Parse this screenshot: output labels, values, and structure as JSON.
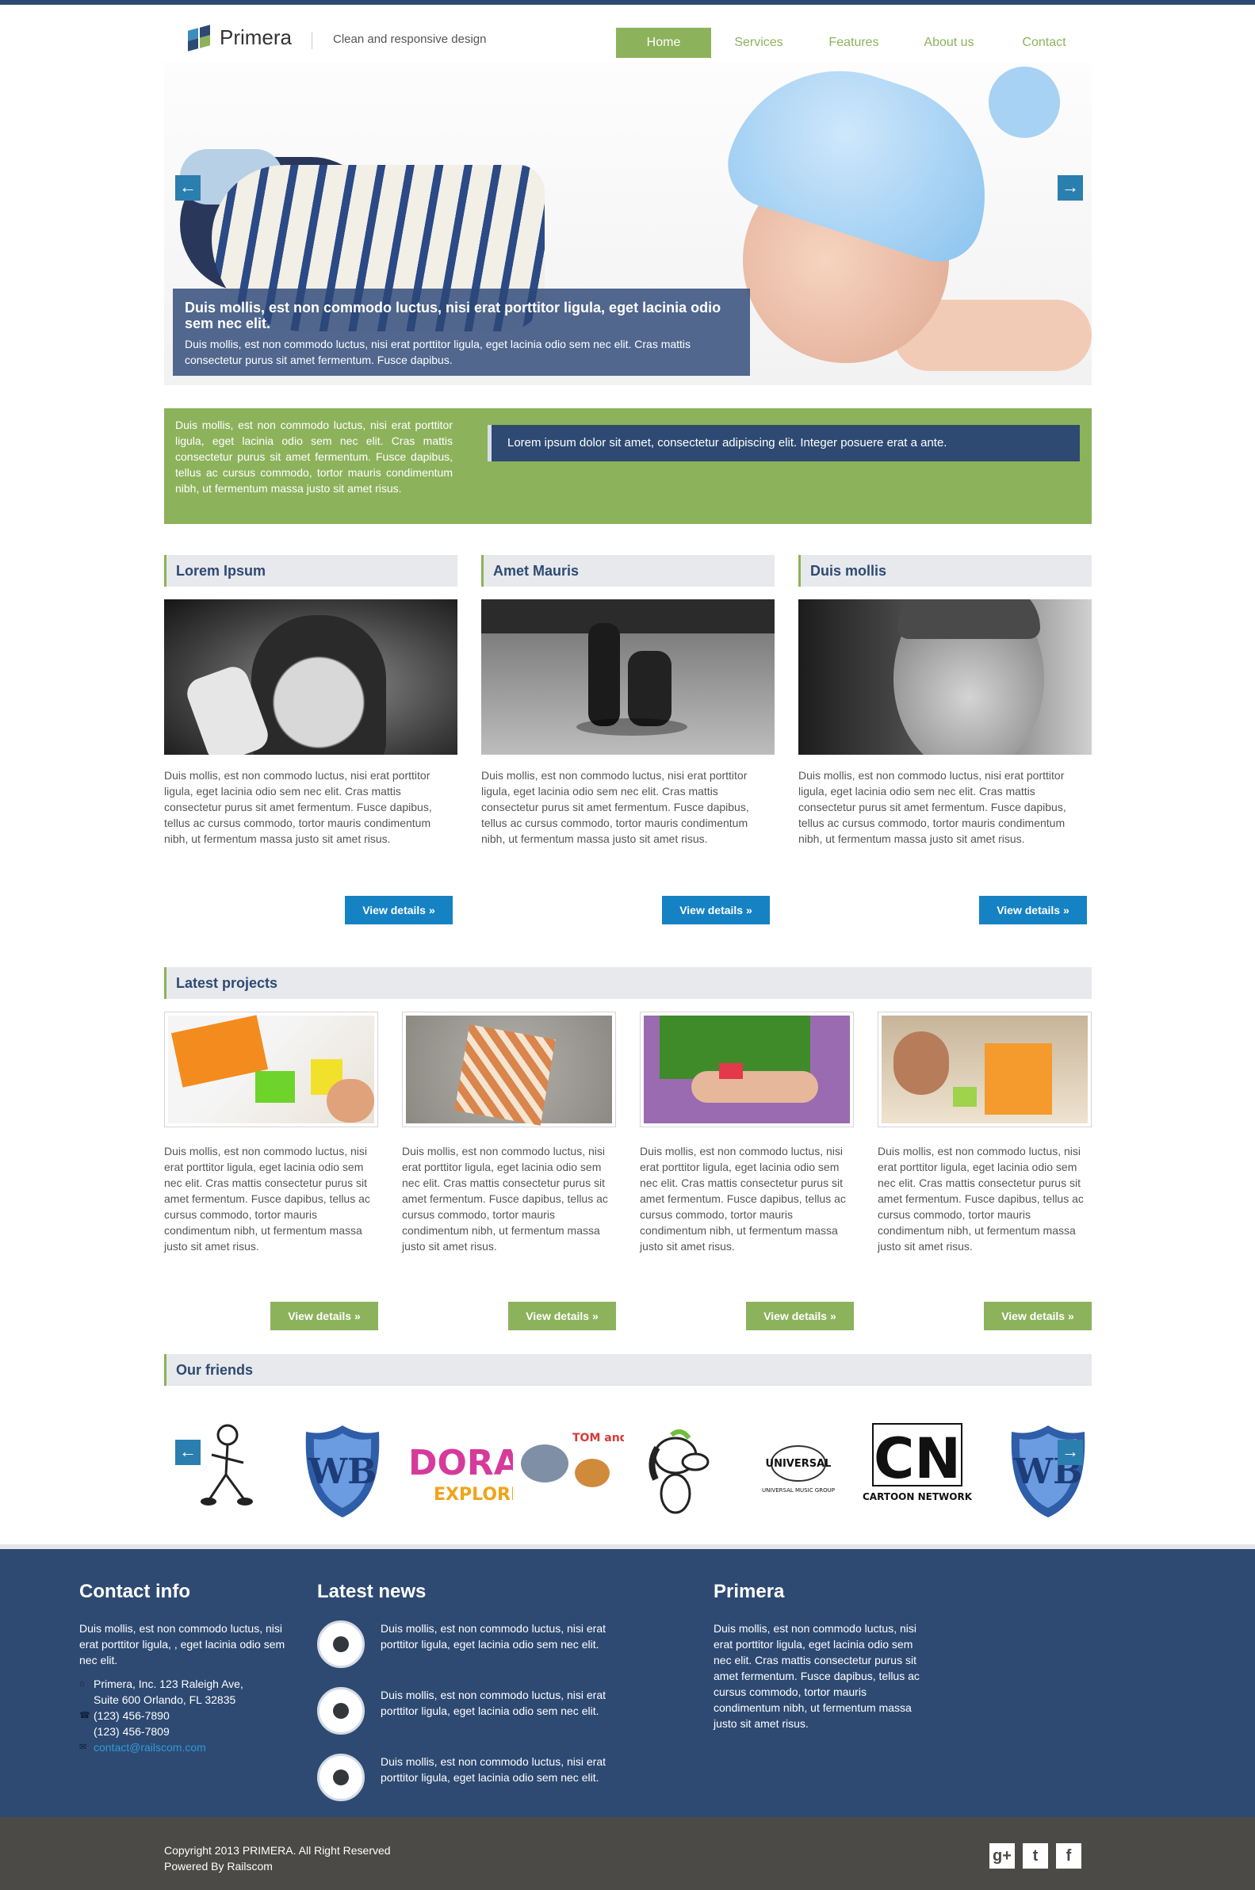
{
  "brand": {
    "name": "Primera",
    "tagline": "Clean and responsive design"
  },
  "nav": {
    "items": [
      "Home",
      "Services",
      "Features",
      "About us",
      "Contact"
    ],
    "active": "Home"
  },
  "slider": {
    "title": "Duis mollis, est non commodo luctus, nisi erat porttitor ligula, eget lacinia odio sem nec elit.",
    "text": "Duis mollis, est non commodo luctus, nisi erat porttitor ligula, eget lacinia odio sem nec elit. Cras mattis consectetur purus sit amet fermentum. Fusce dapibus.",
    "prev": "←",
    "next": "→"
  },
  "band": {
    "text": "Duis mollis, est non commodo luctus, nisi erat porttitor ligula, eget lacinia odio sem nec elit. Cras mattis consectetur purus sit amet fermentum. Fusce dapibus, tellus ac cursus commodo, tortor mauris condimentum nibh, ut fermentum massa justo sit amet risus.",
    "quote": "Lorem ipsum dolor sit amet, consectetur adipiscing elit. Integer posuere erat a ante."
  },
  "features": [
    {
      "title": "Lorem Ipsum",
      "text": "Duis mollis, est non commodo luctus, nisi erat porttitor ligula, eget lacinia odio sem nec elit. Cras mattis consectetur purus sit amet fermentum. Fusce dapibus, tellus ac cursus commodo, tortor mauris condimentum nibh, ut fermentum massa justo sit amet risus.",
      "button": "View details »"
    },
    {
      "title": "Amet Mauris",
      "text": "Duis mollis, est non commodo luctus, nisi erat porttitor ligula, eget lacinia odio sem nec elit. Cras mattis consectetur purus sit amet fermentum. Fusce dapibus, tellus ac cursus commodo, tortor mauris condimentum nibh, ut fermentum massa justo sit amet risus.",
      "button": "View details »"
    },
    {
      "title": "Duis mollis",
      "text": "Duis mollis, est non commodo luctus, nisi erat porttitor ligula, eget lacinia odio sem nec elit. Cras mattis consectetur purus sit amet fermentum. Fusce dapibus, tellus ac cursus commodo, tortor mauris condimentum nibh, ut fermentum massa justo sit amet risus.",
      "button": "View details »"
    }
  ],
  "projects": {
    "title": "Latest projects",
    "items": [
      {
        "text": "Duis mollis, est non commodo luctus, nisi erat porttitor ligula, eget lacinia odio sem nec elit. Cras mattis consectetur purus sit amet fermentum. Fusce dapibus, tellus ac cursus commodo, tortor mauris condimentum nibh, ut fermentum massa justo sit amet risus.",
        "button": "View details »"
      },
      {
        "text": "Duis mollis, est non commodo luctus, nisi erat porttitor ligula, eget lacinia odio sem nec elit. Cras mattis consectetur purus sit amet fermentum. Fusce dapibus, tellus ac cursus commodo, tortor mauris condimentum nibh, ut fermentum massa justo sit amet risus.",
        "button": "View details »"
      },
      {
        "text": "Duis mollis, est non commodo luctus, nisi erat porttitor ligula, eget lacinia odio sem nec elit. Cras mattis consectetur purus sit amet fermentum. Fusce dapibus, tellus ac cursus commodo, tortor mauris condimentum nibh, ut fermentum massa justo sit amet risus.",
        "button": "View details »"
      },
      {
        "text": "Duis mollis, est non commodo luctus, nisi erat porttitor ligula, eget lacinia odio sem nec elit. Cras mattis consectetur purus sit amet fermentum. Fusce dapibus, tellus ac cursus commodo, tortor mauris condimentum nibh, ut fermentum massa justo sit amet risus.",
        "button": "View details »"
      }
    ]
  },
  "friends": {
    "title": "Our friends",
    "logos": {
      "universal_top": "UNIVERSAL",
      "universal_bottom": "UNIVERSAL MUSIC GROUP",
      "cn_letters": "CN",
      "cn_name": "CARTOON NETWORK",
      "dora_top": "DORA",
      "dora_bottom": "EXPLORER",
      "tom": "TOM and JERRY"
    }
  },
  "footer": {
    "contact": {
      "title": "Contact info",
      "text": "Duis mollis, est non commodo luctus, nisi erat porttitor ligula, , eget lacinia odio sem nec elit.",
      "address1": "Primera, Inc. 123 Raleigh Ave,",
      "address2": "Suite 600 Orlando, FL 32835",
      "phone1": "(123) 456-7890",
      "phone2": "(123) 456-7809",
      "email": "contact@railscom.com"
    },
    "news": {
      "title": "Latest news",
      "items": [
        "Duis mollis, est non commodo luctus, nisi erat porttitor ligula, eget lacinia odio sem nec elit.",
        "Duis mollis, est non commodo luctus, nisi erat porttitor ligula, eget lacinia odio sem nec elit.",
        "Duis mollis, est non commodo luctus, nisi erat porttitor ligula, eget lacinia odio sem nec elit."
      ]
    },
    "about": {
      "title": "Primera",
      "text": "Duis mollis, est non commodo luctus, nisi erat porttitor ligula, eget lacinia odio sem nec elit. Cras mattis consectetur purus sit amet fermentum. Fusce dapibus, tellus ac cursus commodo, tortor mauris condimentum nibh, ut fermentum massa justo sit amet risus."
    }
  },
  "bottom": {
    "copyright": "Copyright 2013 PRIMERA. All Right Reserved",
    "powered": "Powered By Railscom",
    "social": [
      "g+",
      "t",
      "f"
    ]
  },
  "colors": {
    "accent": "#8db25c",
    "navy": "#2e4a72",
    "blue_button": "#1582c4",
    "footer_bottom": "#4b4a47"
  }
}
